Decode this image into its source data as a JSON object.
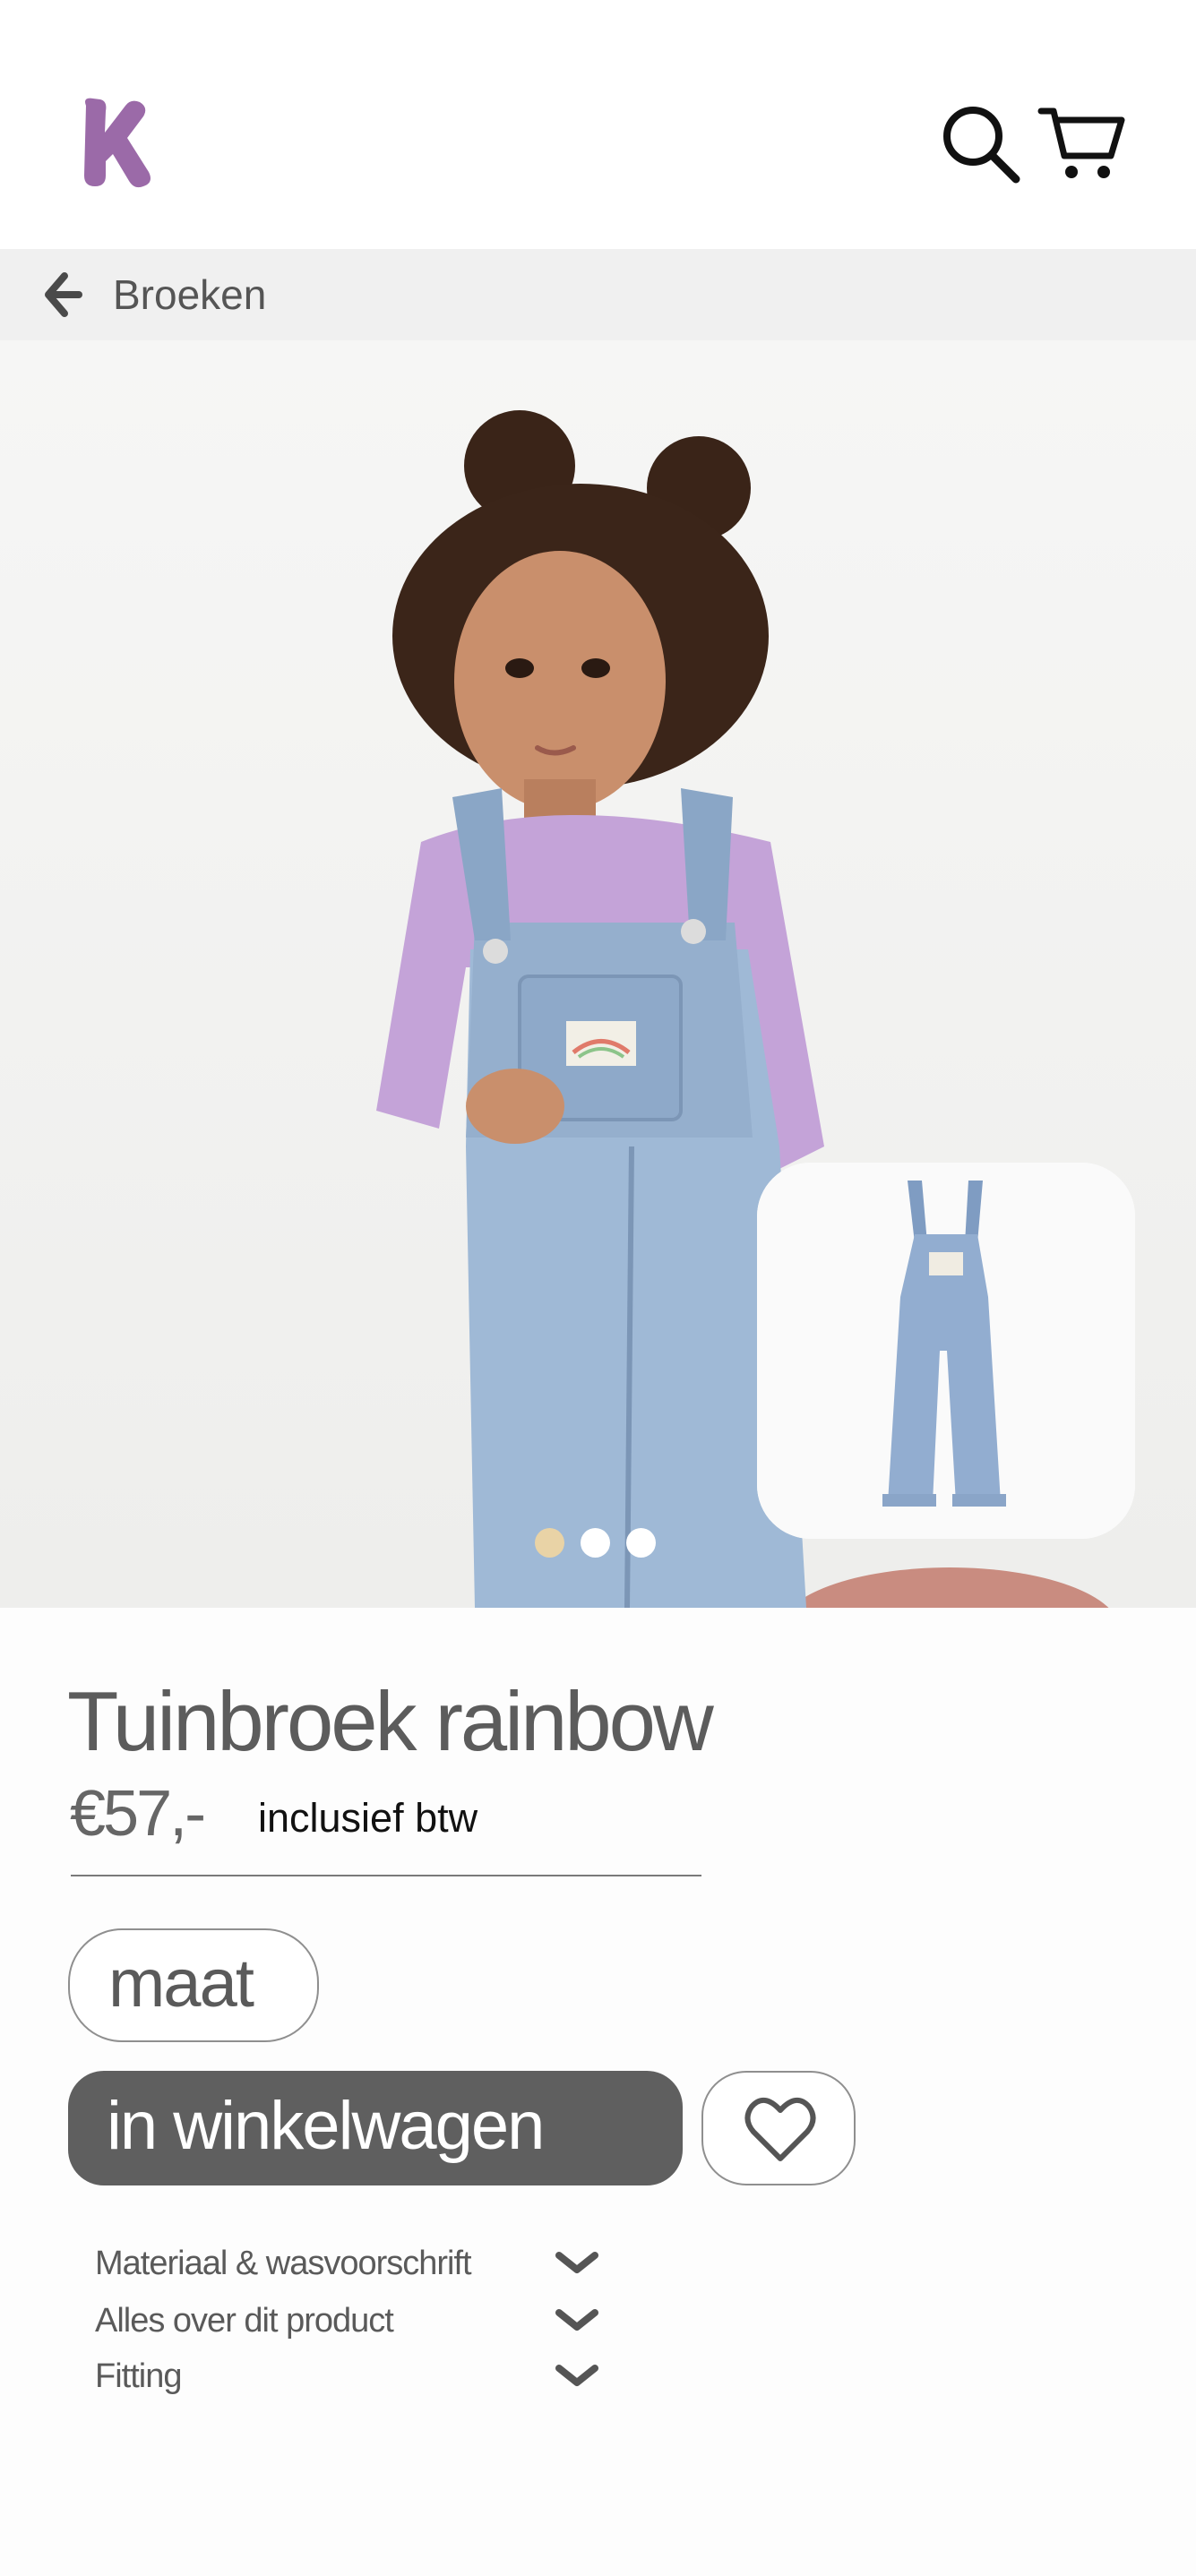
{
  "colors": {
    "brand": "#9b6aa8",
    "primary_button": "#5f5f5f",
    "dot_active": "#e9d3a6",
    "dot_inactive": "#ffffff",
    "breadcrumb_bg": "#f0f0f0"
  },
  "header": {
    "logo_icon": "k-logo-icon",
    "search_icon": "search-icon",
    "cart_icon": "cart-icon"
  },
  "breadcrumb": {
    "back_icon": "arrow-left-icon",
    "label": "Broeken"
  },
  "gallery": {
    "main_image": "child-in-denim-overalls-photo",
    "thumbnail_image": "denim-overalls-product-photo",
    "image_count": 3,
    "active_index": 1
  },
  "product": {
    "title": "Tuinbroek rainbow",
    "price": "€57,-",
    "vat_note": "inclusief btw"
  },
  "actions": {
    "size_label": "maat",
    "add_to_cart_label": "in winkelwagen",
    "favorite_icon": "heart-icon"
  },
  "accordion": [
    {
      "label": "Materiaal & wasvoorschrift",
      "icon": "chevron-down-icon"
    },
    {
      "label": "Alles over dit product",
      "icon": "chevron-down-icon"
    },
    {
      "label": "Fitting",
      "icon": "chevron-down-icon"
    }
  ]
}
